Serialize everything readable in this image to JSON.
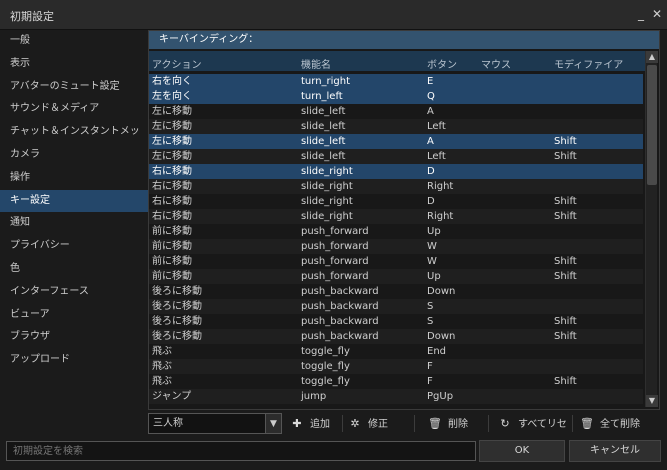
{
  "window": {
    "title": "初期設定",
    "minimize": "_",
    "close": "✕"
  },
  "sidebar": {
    "items": [
      {
        "label": "一般",
        "active": false
      },
      {
        "label": "表示",
        "active": false
      },
      {
        "label": "アバターのミュート設定",
        "active": false
      },
      {
        "label": "サウンド＆メディア",
        "active": false
      },
      {
        "label": "チャット＆インスタントメッ",
        "active": false
      },
      {
        "label": "カメラ",
        "active": false
      },
      {
        "label": "操作",
        "active": false
      },
      {
        "label": "キー設定",
        "active": true
      },
      {
        "label": "通知",
        "active": false
      },
      {
        "label": "プライバシー",
        "active": false
      },
      {
        "label": "色",
        "active": false
      },
      {
        "label": "インターフェース",
        "active": false
      },
      {
        "label": "ビューア",
        "active": false
      },
      {
        "label": "ブラウザ",
        "active": false
      },
      {
        "label": "アップロード",
        "active": false
      }
    ]
  },
  "panel": {
    "header": "キーバインディング：",
    "columns": {
      "action": "アクション",
      "function": "機能名",
      "button": "ボタン",
      "mouse": "マウス",
      "modifier": "モディファイア"
    },
    "rows": [
      {
        "action": "右を向く",
        "function": "turn_right",
        "button": "E",
        "mouse": "",
        "modifier": "",
        "selected": true
      },
      {
        "action": "左を向く",
        "function": "turn_left",
        "button": "Q",
        "mouse": "",
        "modifier": "",
        "selected": true
      },
      {
        "action": "左に移動",
        "function": "slide_left",
        "button": "A",
        "mouse": "",
        "modifier": "",
        "selected": false
      },
      {
        "action": "左に移動",
        "function": "slide_left",
        "button": "Left",
        "mouse": "",
        "modifier": "",
        "selected": false
      },
      {
        "action": "左に移動",
        "function": "slide_left",
        "button": "A",
        "mouse": "",
        "modifier": "Shift",
        "selected": true
      },
      {
        "action": "左に移動",
        "function": "slide_left",
        "button": "Left",
        "mouse": "",
        "modifier": "Shift",
        "selected": false
      },
      {
        "action": "右に移動",
        "function": "slide_right",
        "button": "D",
        "mouse": "",
        "modifier": "",
        "selected": true
      },
      {
        "action": "右に移動",
        "function": "slide_right",
        "button": "Right",
        "mouse": "",
        "modifier": "",
        "selected": false
      },
      {
        "action": "右に移動",
        "function": "slide_right",
        "button": "D",
        "mouse": "",
        "modifier": "Shift",
        "selected": false
      },
      {
        "action": "右に移動",
        "function": "slide_right",
        "button": "Right",
        "mouse": "",
        "modifier": "Shift",
        "selected": false
      },
      {
        "action": "前に移動",
        "function": "push_forward",
        "button": "Up",
        "mouse": "",
        "modifier": "",
        "selected": false
      },
      {
        "action": "前に移動",
        "function": "push_forward",
        "button": "W",
        "mouse": "",
        "modifier": "",
        "selected": false
      },
      {
        "action": "前に移動",
        "function": "push_forward",
        "button": "W",
        "mouse": "",
        "modifier": "Shift",
        "selected": false
      },
      {
        "action": "前に移動",
        "function": "push_forward",
        "button": "Up",
        "mouse": "",
        "modifier": "Shift",
        "selected": false
      },
      {
        "action": "後ろに移動",
        "function": "push_backward",
        "button": "Down",
        "mouse": "",
        "modifier": "",
        "selected": false
      },
      {
        "action": "後ろに移動",
        "function": "push_backward",
        "button": "S",
        "mouse": "",
        "modifier": "",
        "selected": false
      },
      {
        "action": "後ろに移動",
        "function": "push_backward",
        "button": "S",
        "mouse": "",
        "modifier": "Shift",
        "selected": false
      },
      {
        "action": "後ろに移動",
        "function": "push_backward",
        "button": "Down",
        "mouse": "",
        "modifier": "Shift",
        "selected": false
      },
      {
        "action": "飛ぶ",
        "function": "toggle_fly",
        "button": "End",
        "mouse": "",
        "modifier": "",
        "selected": false
      },
      {
        "action": "飛ぶ",
        "function": "toggle_fly",
        "button": "F",
        "mouse": "",
        "modifier": "",
        "selected": false
      },
      {
        "action": "飛ぶ",
        "function": "toggle_fly",
        "button": "F",
        "mouse": "",
        "modifier": "Shift",
        "selected": false
      },
      {
        "action": "ジャンプ",
        "function": "jump",
        "button": "PgUp",
        "mouse": "",
        "modifier": "",
        "selected": false
      }
    ]
  },
  "toolbar": {
    "mode_value": "三人称",
    "add_label": "追加",
    "edit_label": "修正",
    "delete_label": "削除",
    "reset_all_label": "すべてリセ",
    "delete_all_label": "全て削除"
  },
  "bottom": {
    "search_placeholder": "初期設定を検索",
    "ok_label": "OK",
    "cancel_label": "キャンセル"
  },
  "colors": {
    "selection": "#23466a",
    "header": "#33536f",
    "background": "#181818"
  }
}
